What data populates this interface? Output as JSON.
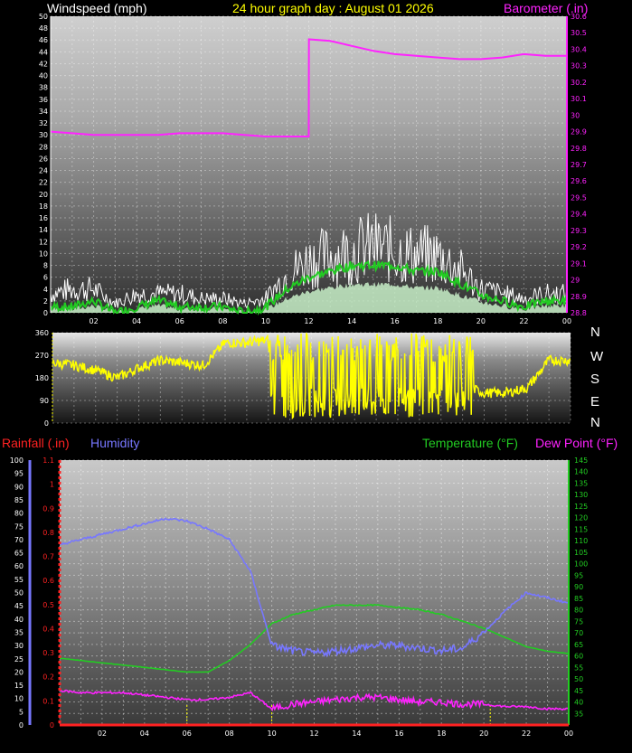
{
  "header": {
    "wind_title": "Windspeed (mph)",
    "date_title": "24 hour graph day : August 01 2026",
    "baro_title": "Barometer (.in)"
  },
  "bottom_header": {
    "rain_title": "Rainfall (.in)",
    "humidity_title": "Humidity",
    "temp_title": "Temperature (°F)",
    "dew_title": "Dew Point (°F)"
  },
  "compass": [
    "N",
    "W",
    "S",
    "E",
    "N"
  ],
  "colors": {
    "wind_gust": "#ffffff",
    "wind_avg": "#22cc22",
    "wind_bg_fill": "#c8f0c8",
    "barometer": "#ff22ff",
    "direction": "#ffff00",
    "humidity": "#7777ff",
    "temperature": "#22cc22",
    "dewpoint": "#ff22ff",
    "rain_axis": "#ff2222"
  },
  "x_tick_labels": [
    "02",
    "04",
    "06",
    "08",
    "10",
    "12",
    "14",
    "16",
    "18",
    "20",
    "22",
    "00"
  ],
  "chart_data": [
    {
      "type": "line",
      "name": "wind-barometer",
      "title": "24 hour graph day : August 01 2026",
      "ylabel": "Windspeed (mph)",
      "y2label": "Barometer (.in)",
      "ylim": [
        0,
        50
      ],
      "y_ticks": [
        0,
        2,
        4,
        6,
        8,
        10,
        12,
        14,
        16,
        18,
        20,
        22,
        24,
        26,
        28,
        30,
        32,
        34,
        36,
        38,
        40,
        42,
        44,
        46,
        48,
        50
      ],
      "y2lim": [
        28.8,
        30.6
      ],
      "y2_ticks": [
        "28.8",
        "28.9",
        "29",
        "29.1",
        "29.2",
        "29.3",
        "29.4",
        "29.5",
        "29.6",
        "29.7",
        "29.8",
        "29.9",
        "30",
        "30.1",
        "30.2",
        "30.3",
        "30.4",
        "30.5",
        "30.6"
      ],
      "x_hours": [
        0,
        1,
        2,
        3,
        4,
        5,
        6,
        7,
        8,
        9,
        10,
        11,
        12,
        12.01,
        13,
        14,
        15,
        16,
        17,
        18,
        19,
        20,
        21,
        22,
        23,
        24
      ],
      "barometer": [
        29.9,
        29.89,
        29.88,
        29.88,
        29.88,
        29.88,
        29.89,
        29.89,
        29.89,
        29.88,
        29.87,
        29.87,
        29.87,
        30.46,
        30.45,
        30.42,
        30.39,
        30.37,
        30.36,
        30.35,
        30.34,
        30.34,
        30.35,
        30.37,
        30.36,
        30.36
      ],
      "x_hours_wind": [
        0,
        1,
        2,
        3,
        4,
        5,
        6,
        7,
        8,
        9,
        10,
        11,
        12,
        13,
        14,
        15,
        16,
        17,
        18,
        19,
        20,
        21,
        22,
        23,
        24
      ],
      "wind_gust": [
        4,
        5,
        5,
        2,
        4,
        4,
        4,
        3,
        3,
        2,
        3,
        8,
        11,
        12,
        13,
        14,
        13,
        12,
        12,
        9,
        5,
        4,
        3,
        4,
        4
      ],
      "wind_avg": [
        1,
        1,
        2,
        0,
        1,
        2,
        1,
        1,
        1,
        0,
        1,
        4,
        6,
        7,
        8,
        8,
        8,
        7,
        7,
        5,
        3,
        2,
        1,
        2,
        2
      ],
      "grid": true
    },
    {
      "type": "line",
      "name": "wind-direction",
      "ylim": [
        0,
        360
      ],
      "y_ticks": [
        0,
        90,
        180,
        270,
        360
      ],
      "x_hours": [
        0,
        1,
        2,
        3,
        4,
        5,
        6,
        7,
        8,
        9,
        10,
        11,
        12,
        13,
        14,
        15,
        16,
        17,
        18,
        19,
        20,
        21,
        22,
        23,
        24
      ],
      "direction": [
        240,
        230,
        210,
        180,
        220,
        250,
        240,
        230,
        320,
        320,
        330,
        180,
        200,
        190,
        210,
        200,
        190,
        210,
        200,
        150,
        120,
        120,
        140,
        250,
        250
      ],
      "grid": true
    },
    {
      "type": "line",
      "name": "temp-humidity",
      "humidity_lim": [
        0,
        100
      ],
      "humidity_ticks": [
        0,
        5,
        10,
        15,
        20,
        25,
        30,
        35,
        40,
        45,
        50,
        55,
        60,
        65,
        70,
        75,
        80,
        85,
        90,
        95,
        100
      ],
      "rain_lim": [
        0,
        1.1
      ],
      "rain_ticks": [
        "0",
        "0.1",
        "0.2",
        "0.3",
        "0.4",
        "0.5",
        "0.6",
        "0.7",
        "0.8",
        "0.9",
        "1",
        "1.1"
      ],
      "temp_lim": [
        30,
        145
      ],
      "temp_ticks": [
        35,
        40,
        45,
        50,
        55,
        60,
        65,
        70,
        75,
        80,
        85,
        90,
        95,
        100,
        105,
        110,
        115,
        120,
        125,
        130,
        135,
        140,
        145
      ],
      "x_hours": [
        0,
        1,
        2,
        3,
        4,
        5,
        6,
        7,
        8,
        9,
        10,
        11,
        12,
        13,
        14,
        15,
        16,
        17,
        18,
        19,
        20,
        21,
        22,
        23,
        24
      ],
      "humidity": [
        68,
        70,
        72,
        74,
        76,
        78,
        77,
        74,
        70,
        58,
        30,
        28,
        27,
        28,
        29,
        30,
        30,
        29,
        28,
        29,
        35,
        43,
        50,
        48,
        46
      ],
      "temperature": [
        59,
        58,
        57,
        56,
        55,
        54,
        53,
        53,
        58,
        65,
        74,
        78,
        80,
        82,
        82,
        82,
        81,
        80,
        78,
        75,
        72,
        68,
        64,
        62,
        61
      ],
      "dewpoint": [
        45,
        44,
        44,
        44,
        43,
        42,
        41,
        41,
        42,
        44,
        37,
        39,
        40,
        41,
        42,
        42,
        41,
        40,
        40,
        39,
        39,
        38,
        38,
        37,
        37
      ],
      "rainfall": 0,
      "grid": true
    }
  ]
}
